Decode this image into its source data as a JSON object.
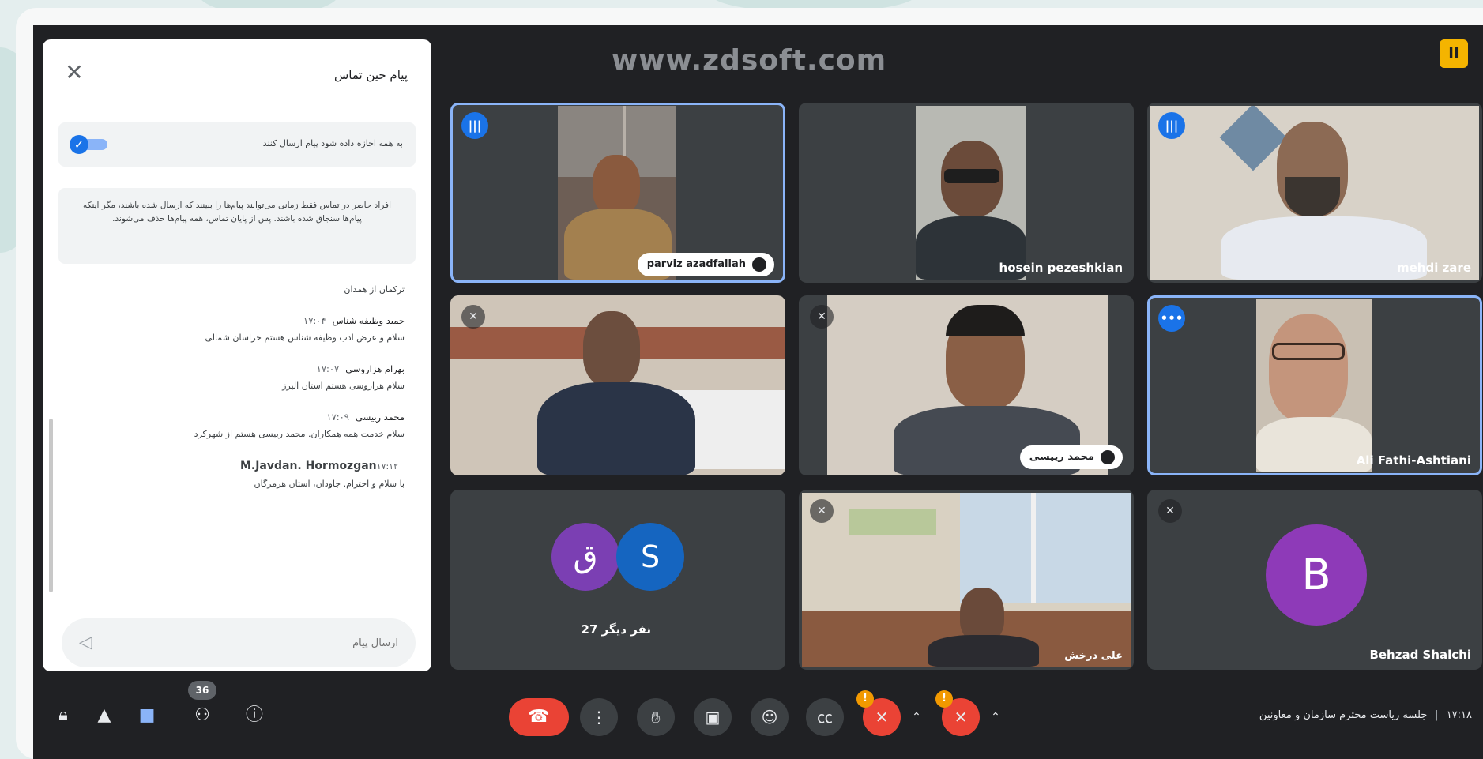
{
  "header": {
    "watermark": "www.zdsoft.com",
    "logo_text": "II"
  },
  "chat": {
    "title": "پیام حین تماس",
    "close_icon": "close-icon",
    "allow_toggle_label": "به همه اجازه داده شود پیام ارسال کنند",
    "allow_toggle_on": true,
    "notice": "افراد حاضر در تماس فقط زمانی می‌توانند پیام‌ها را ببینند که ارسال شده باشند، مگر اینکه پیام‌ها سنجاق شده باشند. پس از پایان تماس، همه پیام‌ها حذف می‌شوند.",
    "messages": [
      {
        "sender": "",
        "time": "",
        "text": "ترکمان از همدان"
      },
      {
        "sender": "حمید وظیفه شناس",
        "time": "۱۷:۰۴",
        "text": "سلام و عرض ادب وظیفه شناس هستم خراسان شمالی"
      },
      {
        "sender": "بهرام هزاروسی",
        "time": "۱۷:۰۷",
        "text": "سلام هزاروسی هستم استان البرز"
      },
      {
        "sender": "محمد رییسی",
        "time": "۱۷:۰۹",
        "text": "سلام خدمت همه همکاران. محمد رییسی هستم از شهرکرد"
      },
      {
        "sender": "M.Javdan. Hormozgan",
        "time": "۱۷:۱۲",
        "text": "با سلام و احترام. جاودان، استان هرمزگان"
      }
    ],
    "input_placeholder": "ارسال پیام",
    "input_value": ""
  },
  "tiles": [
    {
      "name": "parviz azadfallah",
      "style": "pill",
      "indicator": "speaking"
    },
    {
      "name": "hosein pezeshkian",
      "style": "plain",
      "indicator": ""
    },
    {
      "name": "mehdi zare",
      "style": "plain",
      "indicator": "speaking"
    },
    {
      "name": "",
      "style": "none",
      "indicator": "muted"
    },
    {
      "name": "محمد رییسی",
      "style": "pill",
      "indicator": "muted"
    },
    {
      "name": "Ali Fathi-Ashtiani",
      "style": "plain",
      "indicator": "more"
    },
    {
      "name": "27 نفر دیگر",
      "style": "plain",
      "indicator": "",
      "avatars": [
        "ق",
        "S"
      ]
    },
    {
      "name": "علی درخش",
      "style": "plain",
      "indicator": "muted"
    },
    {
      "name": "Behzad Shalchi",
      "style": "plain",
      "indicator": "muted",
      "avatar": "B"
    }
  ],
  "bottom": {
    "people_count": "36",
    "meeting_time": "۱۷:۱۸",
    "meeting_title": "جلسه ریاست محترم سازمان و معاونین",
    "warn_symbol": "!"
  },
  "colors": {
    "accent": "#1a73e8",
    "end_call": "#ea4335",
    "warning": "#f29900",
    "avatar_purple_1": "#7b3fb3",
    "avatar_blue": "#1565c0",
    "avatar_purple_2": "#8e3ab8"
  }
}
